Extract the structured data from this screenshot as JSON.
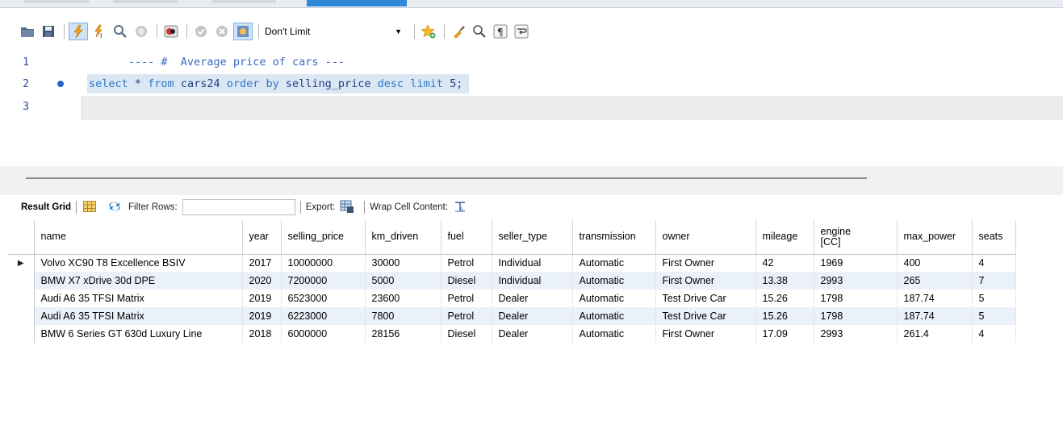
{
  "toolbar": {
    "limit": "Don't Limit"
  },
  "editor": {
    "lines": [
      {
        "num": "1",
        "segments": [
          {
            "cls": "cm",
            "t": "---- #  Average price of cars ---"
          }
        ]
      },
      {
        "num": "2",
        "segments": [
          {
            "cls": "kw",
            "t": "select"
          },
          {
            "cls": "id",
            "t": " * "
          },
          {
            "cls": "kw",
            "t": "from"
          },
          {
            "cls": "id",
            "t": " cars24 "
          },
          {
            "cls": "kw",
            "t": "order by"
          },
          {
            "cls": "id",
            "t": " selling_price "
          },
          {
            "cls": "kw",
            "t": "desc limit"
          },
          {
            "cls": "id",
            "t": " 5;"
          }
        ]
      },
      {
        "num": "3",
        "segments": []
      }
    ]
  },
  "result_toolbar": {
    "result_grid": "Result Grid",
    "filter_rows": "Filter Rows:",
    "export": "Export:",
    "wrap_cell": "Wrap Cell Content:"
  },
  "grid": {
    "columns": [
      "name",
      "year",
      "selling_price",
      "km_driven",
      "fuel",
      "seller_type",
      "transmission",
      "owner",
      "mileage",
      "engine\n[CC]",
      "max_power",
      "seats"
    ],
    "rows": [
      [
        "Volvo XC90 T8 Excellence BSIV",
        "2017",
        "10000000",
        "30000",
        "Petrol",
        "Individual",
        "Automatic",
        "First Owner",
        "42",
        "1969",
        "400",
        "4"
      ],
      [
        "BMW X7 xDrive 30d DPE",
        "2020",
        "7200000",
        "5000",
        "Diesel",
        "Individual",
        "Automatic",
        "First Owner",
        "13.38",
        "2993",
        "265",
        "7"
      ],
      [
        "Audi A6 35 TFSI Matrix",
        "2019",
        "6523000",
        "23600",
        "Petrol",
        "Dealer",
        "Automatic",
        "Test Drive Car",
        "15.26",
        "1798",
        "187.74",
        "5"
      ],
      [
        "Audi A6 35 TFSI Matrix",
        "2019",
        "6223000",
        "7800",
        "Petrol",
        "Dealer",
        "Automatic",
        "Test Drive Car",
        "15.26",
        "1798",
        "187.74",
        "5"
      ],
      [
        "BMW 6 Series GT 630d Luxury Line",
        "2018",
        "6000000",
        "28156",
        "Diesel",
        "Dealer",
        "Automatic",
        "First Owner",
        "17.09",
        "2993",
        "261.4",
        "4"
      ]
    ]
  }
}
